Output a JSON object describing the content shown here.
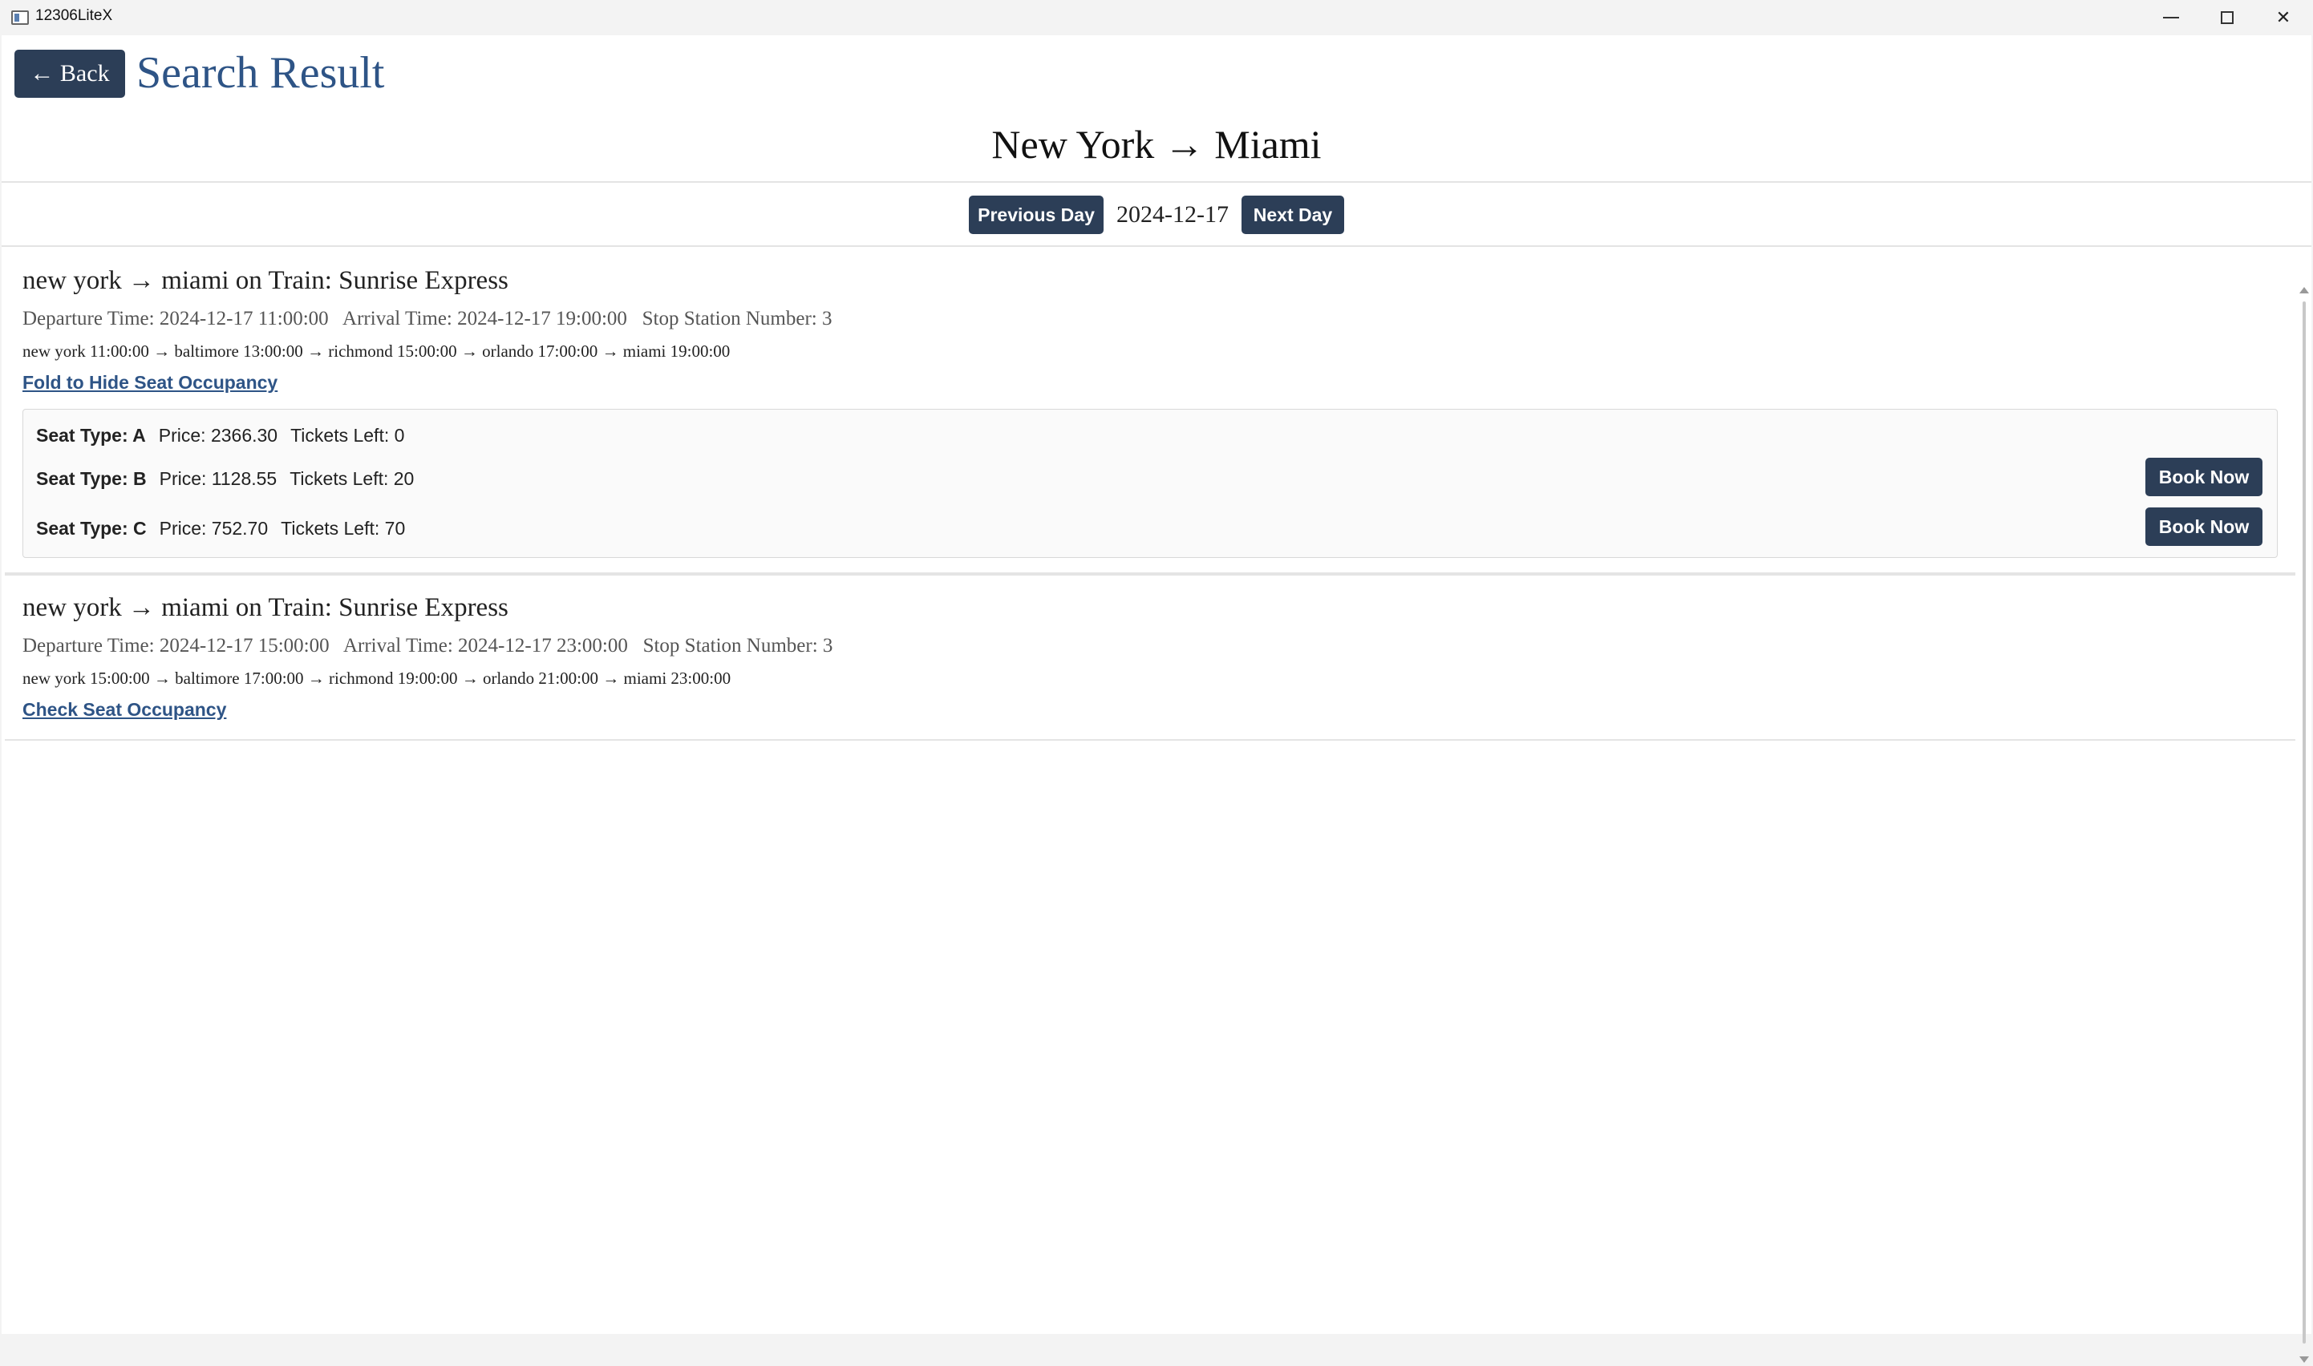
{
  "window": {
    "title": "12306LiteX",
    "minimize_icon": "minimize-icon",
    "maximize_icon": "maximize-icon",
    "close_icon": "close-icon",
    "close_glyph": "✕"
  },
  "header": {
    "back_label": "← Back",
    "page_title": "Search Result",
    "route": "New York → Miami"
  },
  "day_nav": {
    "prev_label": "Previous Day",
    "date": "2024-12-17",
    "next_label": "Next Day"
  },
  "results": [
    {
      "heading": "new york → miami on Train: Sunrise Express",
      "meta": "Departure Time: 2024-12-17 11:00:00   Arrival Time: 2024-12-17 19:00:00   Stop Station Number: 3",
      "stops": "new york 11:00:00 → baltimore 13:00:00 → richmond 15:00:00 → orlando 17:00:00 → miami 19:00:00",
      "toggle_label": "Fold to Hide Seat Occupancy",
      "seats": [
        {
          "type": "Seat Type: A",
          "price": "Price: 2366.30",
          "tickets": "Tickets Left: 0",
          "book_label": ""
        },
        {
          "type": "Seat Type: B",
          "price": "Price: 1128.55",
          "tickets": "Tickets Left: 20",
          "book_label": "Book Now"
        },
        {
          "type": "Seat Type: C",
          "price": "Price: 752.70",
          "tickets": "Tickets Left: 70",
          "book_label": "Book Now"
        }
      ]
    },
    {
      "heading": "new york → miami on Train: Sunrise Express",
      "meta": "Departure Time: 2024-12-17 15:00:00   Arrival Time: 2024-12-17 23:00:00   Stop Station Number: 3",
      "stops": "new york 15:00:00 → baltimore 17:00:00 → richmond 19:00:00 → orlando 21:00:00 → miami 23:00:00",
      "toggle_label": "Check Seat Occupancy"
    }
  ],
  "colors": {
    "accent": "#2c3e57",
    "title_blue": "#2e5486"
  }
}
